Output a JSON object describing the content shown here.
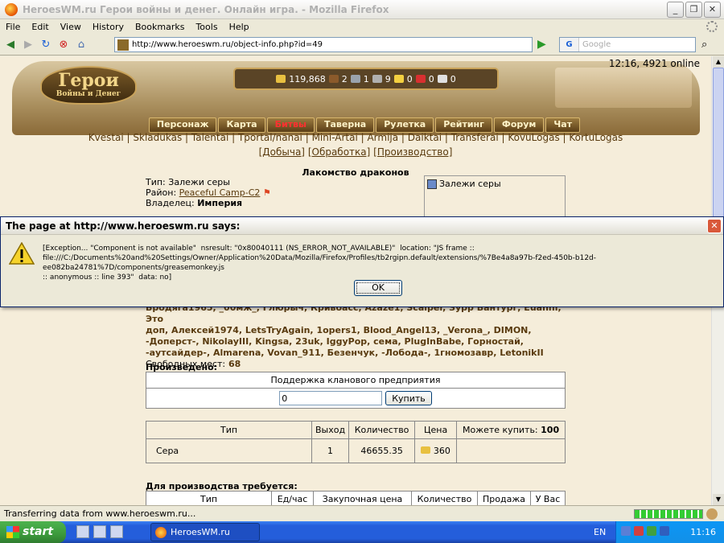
{
  "window": {
    "title": "HeroesWM.ru Герои войны и денег. Онлайн игра. - Mozilla Firefox"
  },
  "menu": [
    "File",
    "Edit",
    "View",
    "History",
    "Bookmarks",
    "Tools",
    "Help"
  ],
  "nav": {
    "url": "http://www.heroeswm.ru/object-info.php?id=49",
    "search_placeholder": "Google"
  },
  "header": {
    "online": "12:16, 4921 online",
    "logo": "Герои",
    "logo_sub": "Войны и Денег",
    "resources": [
      "119,868",
      "2",
      "1",
      "9",
      "0",
      "0",
      "0"
    ],
    "menu": [
      "Персонаж",
      "Карта",
      "Битвы",
      "Таверна",
      "Рулетка",
      "Рейтинг",
      "Форум",
      "Чат"
    ]
  },
  "links1": "Kvestai | Skladukas | Talentai | Tportal/nanai | Mini-Artai | Armija | Daiktai | Transferai | KovuLogas | KortuLogas",
  "links2": [
    "[Добыча]",
    "[Обработка]",
    "[Производство]"
  ],
  "object": {
    "title": "Лакомство драконов",
    "type_label": "Тип:",
    "type_value": "Залежи серы",
    "region_label": "Район:",
    "region_value": "Peaceful Camp-C2",
    "owner_label": "Владелец:",
    "owner_value": "Империя",
    "sidebox_item": "Залежи серы"
  },
  "dialog": {
    "title": "The page at http://www.heroeswm.ru says:",
    "message": "[Exception... \"Component is not available\"  nsresult: \"0x80040111 (NS_ERROR_NOT_AVAILABLE)\"  location: \"JS frame :: file:///C:/Documents%20and%20Settings/Owner/Application%20Data/Mozilla/Firefox/Profiles/tb2rgipn.default/extensions/%7Be4a8a97b-f2ed-450b-b12d-ee082ba24781%7D/components/greasemonkey.js\n:: anonymous :: line 393\"  data: no]",
    "ok": "OK"
  },
  "workers": {
    "lines": [
      "Бродяга1965, _00мж_, Глюрыч, Кривоасс, Azaze1, Scalper, Зурр Вантург, Euanni, Это",
      "доп, Алексей1974, LetsTryAgain, 1opers1, Blood_Angel13, _Verona_, DIMON,",
      "-Доперст-, NikolayIII, Kingsa, 23uk, IggyPop, сема, PlugInBabe, Горностай,",
      "-аутсайдер-, Almarena, Vovan_911, Безенчук, -Лобода-, 1гномозавр, LetonikII"
    ],
    "free_label": "Свободных мест:",
    "free_value": "68"
  },
  "produced": {
    "heading": "Произведено:",
    "box_title": "Поддержка кланового предприятия",
    "input_value": "0",
    "buy": "Купить"
  },
  "table1": {
    "headers": [
      "Тип",
      "Выход",
      "Количество",
      "Цена"
    ],
    "can_buy_label": "Можете купить:",
    "can_buy_value": "100",
    "row": {
      "type": "Сера",
      "output": "1",
      "qty": "46655.35",
      "price": "360"
    }
  },
  "required": {
    "heading": "Для производства требуется:",
    "headers": [
      "Тип",
      "Ед/час",
      "Закупочная цена",
      "Количество",
      "Продажа",
      "У Вас"
    ]
  },
  "status": "Transferring data from www.heroeswm.ru...",
  "taskbar": {
    "start": "start",
    "item": "HeroesWM.ru Герон ...",
    "lang": "EN",
    "clock": "11:16"
  }
}
